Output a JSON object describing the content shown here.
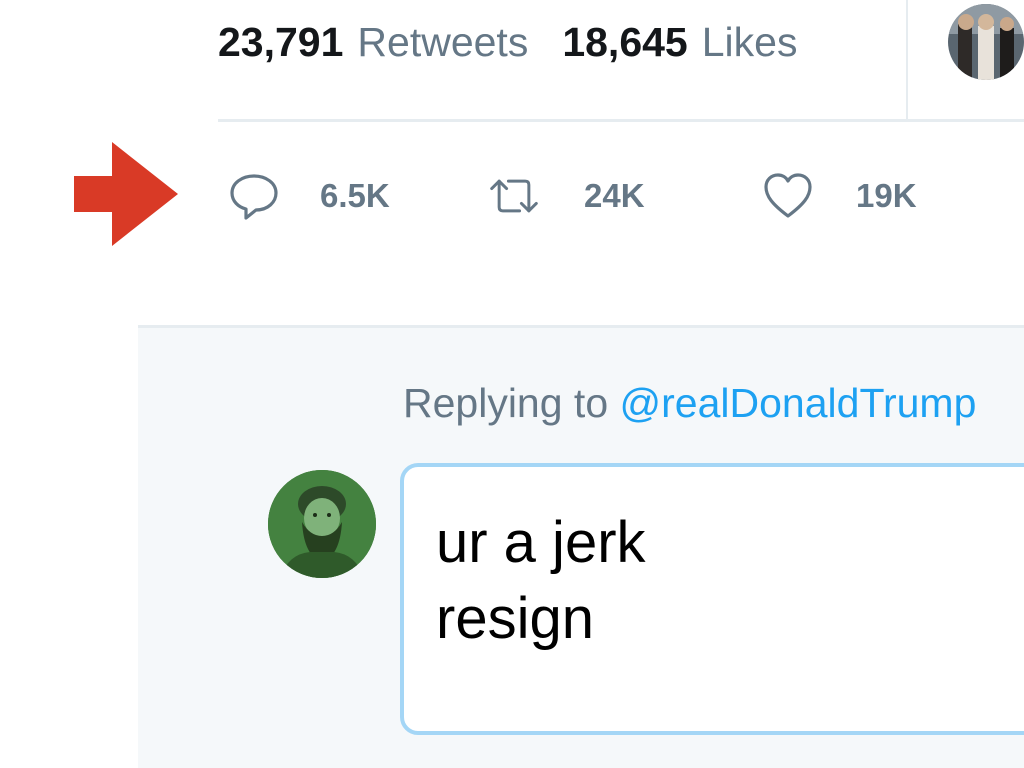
{
  "stats": {
    "retweets_count": "23,791",
    "retweets_label": "Retweets",
    "likes_count": "18,645",
    "likes_label": "Likes"
  },
  "actions": {
    "reply": {
      "icon": "reply-bubble-icon",
      "count": "6.5K"
    },
    "retweet": {
      "icon": "retweet-icon",
      "count": "24K"
    },
    "like": {
      "icon": "heart-icon",
      "count": "19K"
    }
  },
  "annotation": {
    "icon": "red-arrow-icon",
    "color": "#d93a26"
  },
  "reply": {
    "replying_prefix": "Replying to",
    "mention": "@realDonaldTrump",
    "composer_line1": "ur a jerk",
    "composer_line2": "resign"
  },
  "colors": {
    "text_secondary": "#657786",
    "link": "#1da1f2",
    "border": "#e6ecf0",
    "panel_bg": "#f5f8fa",
    "composer_border": "#a4d6f6"
  }
}
